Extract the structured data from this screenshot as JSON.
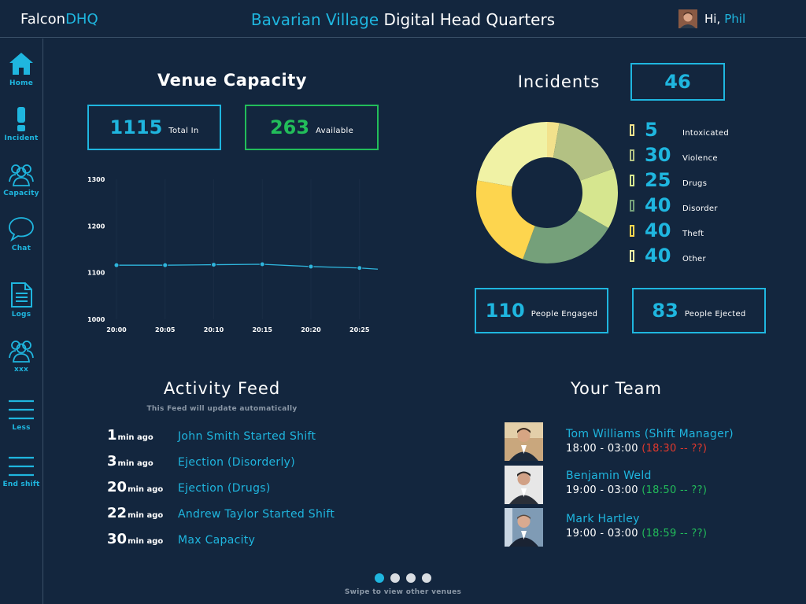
{
  "header": {
    "brand_prefix": "Falcon",
    "brand_suffix": "DHQ",
    "title_prefix": "Bavarian Village",
    "title_suffix": "Digital Head Quarters",
    "greeting": "Hi,",
    "user_name": "Phil"
  },
  "sidebar": {
    "items": [
      {
        "label": "Home",
        "icon": "home-icon"
      },
      {
        "label": "Incident",
        "icon": "exclamation-icon"
      },
      {
        "label": "Capacity",
        "icon": "people-icon"
      },
      {
        "label": "Chat",
        "icon": "chat-bubble-icon"
      },
      {
        "label": "Logs",
        "icon": "document-icon"
      },
      {
        "label": "xxx",
        "icon": "people-icon"
      },
      {
        "label": "Less",
        "icon": "menu-icon"
      },
      {
        "label": "End shift",
        "icon": "menu-icon"
      }
    ]
  },
  "capacity": {
    "title": "Venue Capacity",
    "total_in": "1115",
    "total_in_label": "Total In",
    "available": "263",
    "available_label": "Available"
  },
  "chart_data": {
    "type": "line",
    "title": "",
    "xlabel": "",
    "ylabel": "",
    "x": [
      "20:00",
      "20:05",
      "20:10",
      "20:15",
      "20:20",
      "20:25"
    ],
    "x_ticks": [
      "20:00",
      "20:05",
      "20:10",
      "20:15",
      "20:20",
      "20:25"
    ],
    "y_ticks": [
      "1300",
      "1200",
      "1100",
      "1000"
    ],
    "ylim": [
      1000,
      1300
    ],
    "series": [
      {
        "values": [
          1116,
          1116,
          1117,
          1118,
          1113,
          1110
        ],
        "color": "#2fb5dc"
      }
    ],
    "grid": false
  },
  "incidents": {
    "title": "Incidents",
    "total": "46",
    "categories": [
      {
        "value": "5",
        "label": "Intoxicated",
        "color": "#f2e28c"
      },
      {
        "value": "30",
        "label": "Violence",
        "color": "#b3c183"
      },
      {
        "value": "25",
        "label": "Drugs",
        "color": "#d6e68f"
      },
      {
        "value": "40",
        "label": "Disorder",
        "color": "#75a07a"
      },
      {
        "value": "40",
        "label": "Theft",
        "color": "#fdd54e"
      },
      {
        "value": "40",
        "label": "Other",
        "color": "#f0f2a5"
      }
    ],
    "engaged": "110",
    "engaged_label": "People Engaged",
    "ejected": "83",
    "ejected_label": "People Ejected"
  },
  "feed": {
    "title": "Activity Feed",
    "subtitle": "This Feed will update automatically",
    "items": [
      {
        "n": "1",
        "unit": "min ago",
        "text": "John Smith Started Shift"
      },
      {
        "n": "3",
        "unit": "min ago",
        "text": "Ejection (Disorderly)"
      },
      {
        "n": "20",
        "unit": "min ago",
        "text": "Ejection (Drugs)"
      },
      {
        "n": "22",
        "unit": "min ago",
        "text": "Andrew Taylor Started Shift"
      },
      {
        "n": "30",
        "unit": "min ago",
        "text": "Max Capacity"
      }
    ]
  },
  "team": {
    "title": "Your Team",
    "members": [
      {
        "name": "Tom Williams (Shift Manager)",
        "shift": "18:00 - 03:00",
        "actual": "(18:30 -- ??)",
        "status": "late"
      },
      {
        "name": "Benjamin Weld",
        "shift": "19:00 - 03:00",
        "actual": "(18:50 -- ??)",
        "status": "ok"
      },
      {
        "name": "Mark Hartley",
        "shift": "19:00 - 03:00",
        "actual": "(18:59 -- ??)",
        "status": "ok"
      }
    ]
  },
  "pager": {
    "pages": 4,
    "active": 1,
    "hint": "Swipe to view other venues"
  }
}
